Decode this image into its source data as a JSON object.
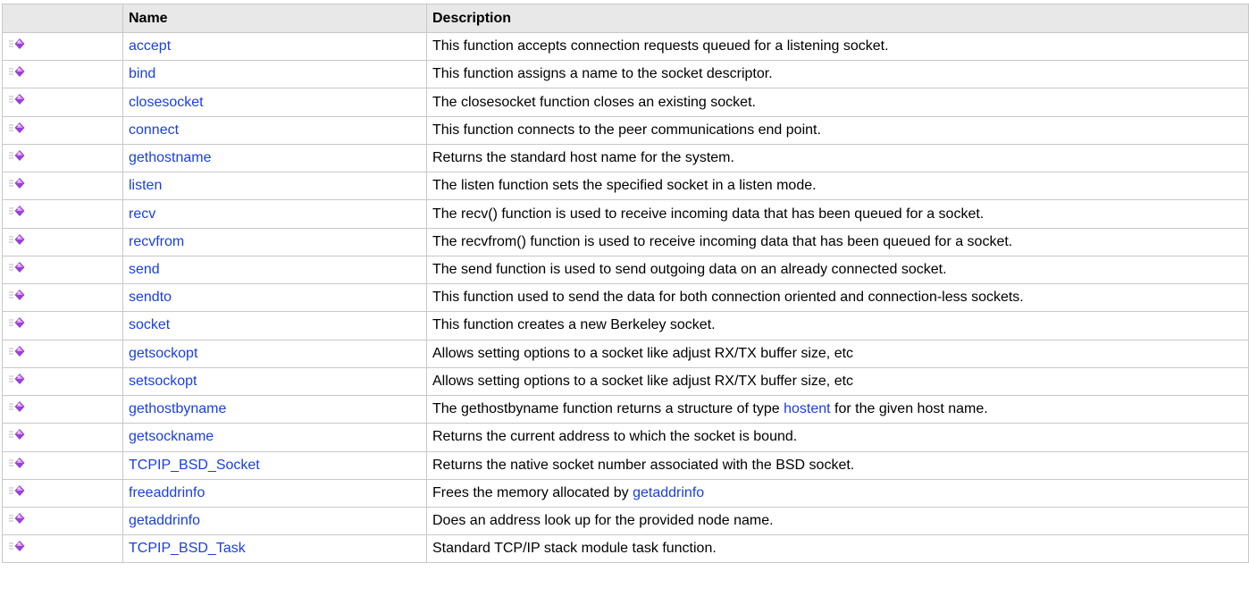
{
  "columns": {
    "icon": "",
    "name": "Name",
    "description": "Description"
  },
  "icon_name": "public-method-icon",
  "colors": {
    "link": "#1a3fe0",
    "header_bg": "#e8e8e8",
    "border": "#c8c8c8",
    "icon_purple": "#9b3fd6"
  },
  "rows": [
    {
      "name": "accept",
      "description": "This function accepts connection requests queued for a listening socket."
    },
    {
      "name": "bind",
      "description": "This function assigns a name to the socket descriptor."
    },
    {
      "name": "closesocket",
      "description": "The closesocket function closes an existing socket."
    },
    {
      "name": "connect",
      "description": "This function connects to the peer communications end point."
    },
    {
      "name": "gethostname",
      "description": "Returns the standard host name for the system."
    },
    {
      "name": "listen",
      "description": "The listen function sets the specified socket in a listen mode."
    },
    {
      "name": "recv",
      "description": "The recv() function is used to receive incoming data that has been queued for a socket."
    },
    {
      "name": "recvfrom",
      "description": "The recvfrom() function is used to receive incoming data that has been queued for a socket."
    },
    {
      "name": "send",
      "description": "The send function is used to send outgoing data on an already connected socket."
    },
    {
      "name": "sendto",
      "description": "This function used to send the data for both connection oriented and connection-less sockets."
    },
    {
      "name": "socket",
      "description": "This function creates a new Berkeley socket."
    },
    {
      "name": "getsockopt",
      "description": "Allows setting options to a socket like adjust RX/TX buffer size, etc"
    },
    {
      "name": "setsockopt",
      "description": "Allows setting options to a socket like adjust RX/TX buffer size, etc"
    },
    {
      "name": "gethostbyname",
      "description_before": "The gethostbyname function returns a structure of type ",
      "description_link": "hostent",
      "description_after": " for the given host name."
    },
    {
      "name": "getsockname",
      "description": "Returns the current address to which the socket is bound."
    },
    {
      "name": "TCPIP_BSD_Socket",
      "description": "Returns the native socket number associated with the BSD socket."
    },
    {
      "name": "freeaddrinfo",
      "description_before": "Frees the memory allocated by ",
      "description_link": "getaddrinfo",
      "description_after": ""
    },
    {
      "name": "getaddrinfo",
      "description": "Does an address look up for the provided node name."
    },
    {
      "name": "TCPIP_BSD_Task",
      "description": "Standard TCP/IP stack module task function."
    }
  ]
}
